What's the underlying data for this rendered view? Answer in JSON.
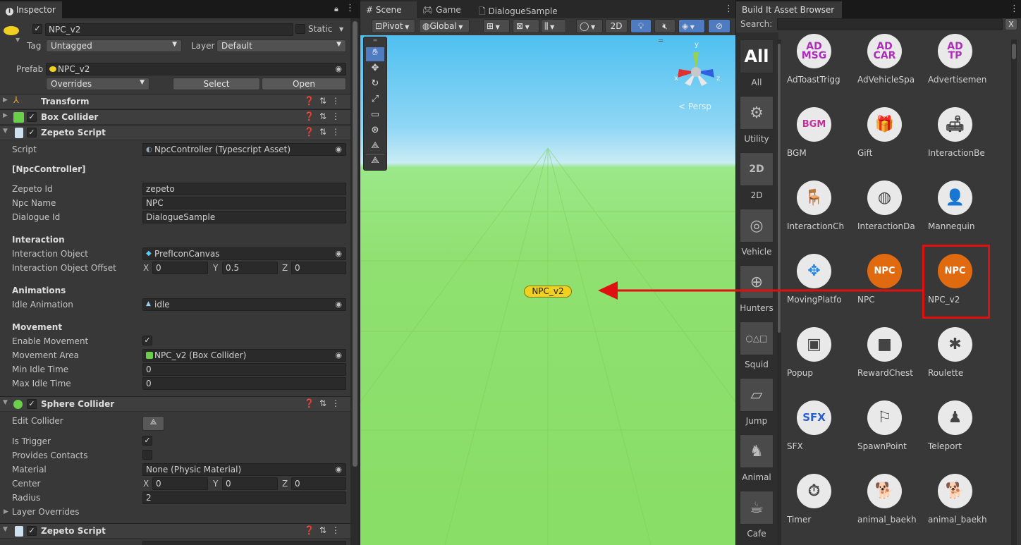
{
  "inspector": {
    "tab": "Inspector",
    "object_name": "NPC_v2",
    "static_label": "Static",
    "tag_label": "Tag",
    "tag_value": "Untagged",
    "layer_label": "Layer",
    "layer_value": "Default",
    "prefab_label": "Prefab",
    "prefab_value": "NPC_v2",
    "overrides": "Overrides",
    "select_btn": "Select",
    "open_btn": "Open",
    "components": {
      "transform": "Transform",
      "box_collider": "Box Collider",
      "zepeto_script": "Zepeto Script",
      "sphere_collider": "Sphere Collider",
      "zepeto_script2": "Zepeto Script"
    },
    "script_label": "Script",
    "script_value": "NpcController (Typescript Asset)",
    "npc_controller_header": "[NpcController]",
    "zepeto_id_label": "Zepeto Id",
    "zepeto_id_value": "zepeto",
    "npc_name_label": "Npc Name",
    "npc_name_value": "NPC",
    "dialogue_id_label": "Dialogue Id",
    "dialogue_id_value": "DialogueSample",
    "interaction_header": "Interaction",
    "interaction_object_label": "Interaction Object",
    "interaction_object_value": "PrefIconCanvas",
    "interaction_offset_label": "Interaction Object Offset",
    "offset_x": "0",
    "offset_y": "0.5",
    "offset_z": "0",
    "animations_header": "Animations",
    "idle_animation_label": "Idle Animation",
    "idle_animation_value": "idle",
    "movement_header": "Movement",
    "enable_movement_label": "Enable Movement",
    "movement_area_label": "Movement Area",
    "movement_area_value": "NPC_v2 (Box Collider)",
    "min_idle_label": "Min Idle Time",
    "min_idle_value": "0",
    "max_idle_label": "Max Idle Time",
    "max_idle_value": "0",
    "edit_collider_label": "Edit Collider",
    "is_trigger_label": "Is Trigger",
    "provides_contacts_label": "Provides Contacts",
    "material_label": "Material",
    "material_value": "None (Physic Material)",
    "center_label": "Center",
    "center_x": "0",
    "center_y": "0",
    "center_z": "0",
    "radius_label": "Radius",
    "radius_value": "2",
    "layer_overrides_label": "Layer Overrides",
    "x": "X",
    "y": "Y",
    "z": "Z",
    "check": "✓"
  },
  "scene": {
    "tabs": [
      "Scene",
      "Game",
      "DialogueSample"
    ],
    "pivot": "Pivot",
    "global": "Global",
    "mode_2d": "2D",
    "persp": "< Persp",
    "npc_label": "NPC_v2",
    "gizmo_y": "y",
    "gizmo_x": "x",
    "gizmo_z": "z"
  },
  "browser": {
    "title": "Build It Asset Browser",
    "search_label": "Search:",
    "clear": "X",
    "categories": [
      {
        "icon": "All",
        "label": "All"
      },
      {
        "icon": "⚙",
        "label": "Utility"
      },
      {
        "icon": "2D",
        "label": "2D"
      },
      {
        "icon": "◎",
        "label": "Vehicle"
      },
      {
        "icon": "⊕",
        "label": "Hunters"
      },
      {
        "icon": "○△□",
        "label": "Squid"
      },
      {
        "icon": "▱",
        "label": "Jump"
      },
      {
        "icon": "♞",
        "label": "Animal"
      },
      {
        "icon": "☕",
        "label": "Cafe"
      }
    ],
    "assets": [
      {
        "icon": "AD\nMSG",
        "label": "AdToastTrigg"
      },
      {
        "icon": "AD\nCAR",
        "label": "AdVehicleSpa"
      },
      {
        "icon": "AD\nTP",
        "label": "Advertisemen"
      },
      {
        "icon": "BGM",
        "label": "BGM"
      },
      {
        "icon": "🎁",
        "label": "Gift"
      },
      {
        "icon": "🛋",
        "label": "InteractionBe"
      },
      {
        "icon": "🪑",
        "label": "InteractionCh"
      },
      {
        "icon": "◍",
        "label": "InteractionDa"
      },
      {
        "icon": "👤",
        "label": "Mannequin"
      },
      {
        "icon": "✥",
        "label": "MovingPlatfo"
      },
      {
        "icon": "NPC",
        "label": "NPC"
      },
      {
        "icon": "NPC",
        "label": "NPC_v2"
      },
      {
        "icon": "▣",
        "label": "Popup"
      },
      {
        "icon": "■",
        "label": "RewardChest"
      },
      {
        "icon": "✱",
        "label": "Roulette"
      },
      {
        "icon": "SFX",
        "label": "SFX"
      },
      {
        "icon": "⚐",
        "label": "SpawnPoint"
      },
      {
        "icon": "♟",
        "label": "Teleport"
      },
      {
        "icon": "⏱",
        "label": "Timer"
      },
      {
        "icon": "🐕",
        "label": "animal_baekh"
      },
      {
        "icon": "🐕",
        "label": "animal_baekh"
      }
    ]
  },
  "colors": {
    "npc_orange": "#e06a10",
    "highlight_red": "#e01010",
    "label_yellow": "#f0d020"
  }
}
